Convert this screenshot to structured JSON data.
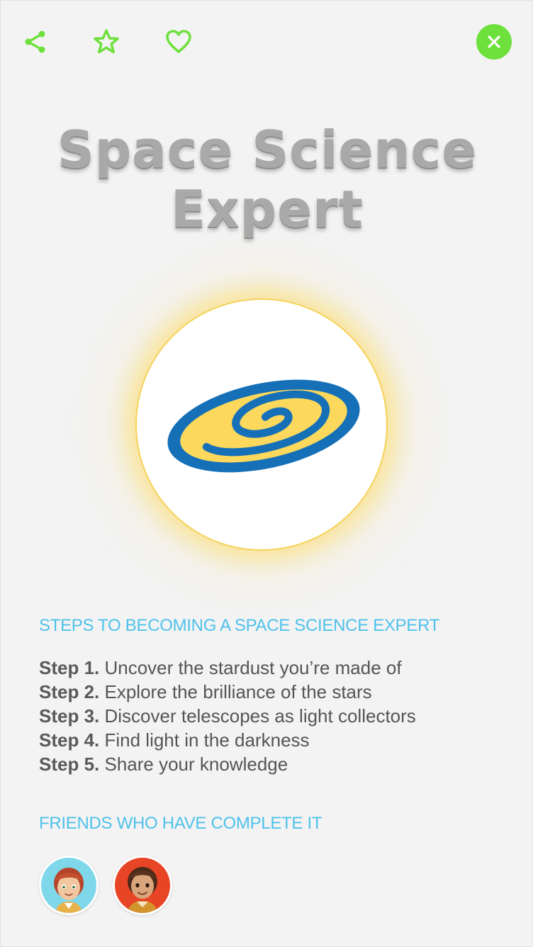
{
  "toolbar": {
    "share_icon": "share-icon",
    "favorite_icon": "star-icon",
    "like_icon": "heart-icon",
    "close_icon": "close-icon",
    "icon_color": "#6ee03c"
  },
  "badge": {
    "title_line1": "Space Science",
    "title_line2": "Expert",
    "image": "galaxy-swirl-badge",
    "colors": {
      "ring": "#1570b8",
      "fill": "#fcd85c",
      "glow": "#ffd650"
    }
  },
  "steps_section": {
    "heading": "STEPS TO BECOMING A SPACE SCIENCE EXPERT",
    "steps": [
      {
        "label": "Step 1.",
        "text": "Uncover the stardust you’re made of"
      },
      {
        "label": "Step 2.",
        "text": "Explore the brilliance of the stars"
      },
      {
        "label": "Step 3.",
        "text": "Discover telescopes as light collectors"
      },
      {
        "label": "Step 4.",
        "text": "Find light in the darkness"
      },
      {
        "label": "Step 5.",
        "text": "Share your knowledge"
      }
    ]
  },
  "friends_section": {
    "heading": "FRIENDS WHO HAVE COMPLETE IT",
    "friends": [
      {
        "avatar": "friend-avatar-redhead-girl",
        "bg": "#7fd8ea"
      },
      {
        "avatar": "friend-avatar-dark-hair-kid",
        "bg": "#e84426"
      }
    ]
  },
  "accent_color": "#4fc2ea"
}
